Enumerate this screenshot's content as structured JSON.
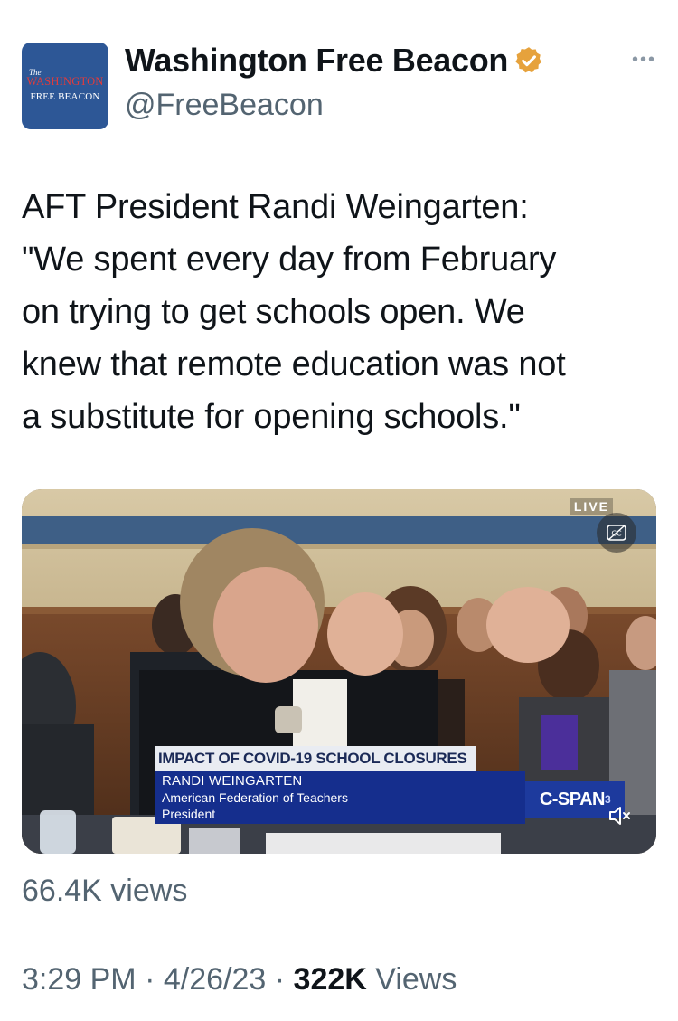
{
  "account": {
    "avatar_text": {
      "the": "The",
      "line1": "WASHINGTON",
      "line2": "FREE BEACON"
    },
    "display_name": "Washington Free Beacon",
    "handle": "@FreeBeacon",
    "verified_badge_color": "#e6a23c"
  },
  "tweet": {
    "text_lines": [
      "AFT President Randi Weingarten:",
      "\"We spent every day from February",
      "on trying to get schools open. We",
      "knew that remote education was not",
      "a substitute for opening schools.\""
    ]
  },
  "media": {
    "live_label": "LIVE",
    "chyron": {
      "title": "IMPACT OF COVID-19 SCHOOL CLOSURES",
      "name": "RANDI WEINGARTEN",
      "organization": "American Federation of Teachers",
      "role": "President"
    },
    "network": "C-SPAN",
    "network_number": "3",
    "icons": {
      "captions": "closed-captions-icon",
      "mute": "muted-speaker-icon"
    }
  },
  "video_views": "66.4K views",
  "meta": {
    "time": "3:29 PM",
    "separator": "·",
    "date": "4/26/23",
    "views_count": "322K",
    "views_label": "Views"
  },
  "colors": {
    "text_primary": "#0f1419",
    "text_secondary": "#536471",
    "chyron_blue": "#152e8d",
    "avatar_blue": "#2d5796"
  }
}
